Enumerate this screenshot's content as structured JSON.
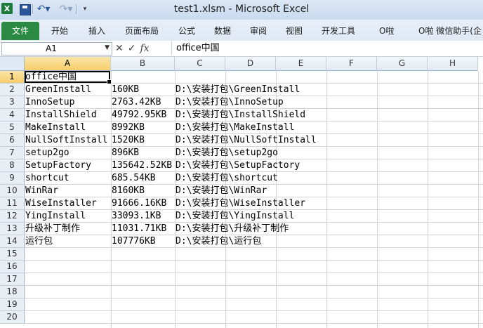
{
  "window": {
    "title": "test1.xlsm  -  Microsoft Excel"
  },
  "quick_access": {
    "icons": [
      "excel-icon",
      "save-icon",
      "undo-icon",
      "redo-icon",
      "customize-icon"
    ]
  },
  "ribbon": {
    "file_tab": "文件",
    "tabs": [
      "开始",
      "插入",
      "页面布局",
      "公式",
      "数据",
      "审阅",
      "视图",
      "开发工具",
      "O啦",
      "O啦 微信助手(企"
    ]
  },
  "formula_bar": {
    "name_box": "A1",
    "content": "office中国"
  },
  "columns": [
    "A",
    "B",
    "C",
    "D",
    "E",
    "F",
    "G",
    "H"
  ],
  "rows": [
    "1",
    "2",
    "3",
    "4",
    "5",
    "6",
    "7",
    "8",
    "9",
    "10",
    "11",
    "12",
    "13",
    "14",
    "15",
    "16",
    "17",
    "18",
    "19",
    "20"
  ],
  "cells": [
    {
      "a": "office中国",
      "b": "",
      "c": ""
    },
    {
      "a": "GreenInstall",
      "b": "160KB",
      "c": "D:\\安装打包\\GreenInstall"
    },
    {
      "a": "InnoSetup",
      "b": "2763.42KB",
      "c": "D:\\安装打包\\InnoSetup"
    },
    {
      "a": "InstallShield",
      "b": "49792.95KB",
      "c": "D:\\安装打包\\InstallShield"
    },
    {
      "a": "MakeInstall",
      "b": "8992KB",
      "c": "D:\\安装打包\\MakeInstall"
    },
    {
      "a": "NullSoftInstall",
      "b": "1520KB",
      "c": "D:\\安装打包\\NullSoftInstall"
    },
    {
      "a": "setup2go",
      "b": "896KB",
      "c": "D:\\安装打包\\setup2go"
    },
    {
      "a": "SetupFactory",
      "b": "135642.52KB",
      "c": "D:\\安装打包\\SetupFactory"
    },
    {
      "a": "shortcut",
      "b": "685.54KB",
      "c": "D:\\安装打包\\shortcut"
    },
    {
      "a": "WinRar",
      "b": "8160KB",
      "c": "D:\\安装打包\\WinRar"
    },
    {
      "a": "WiseInstaller",
      "b": "91666.16KB",
      "c": "D:\\安装打包\\WiseInstaller"
    },
    {
      "a": "YingInstall",
      "b": "33093.1KB",
      "c": "D:\\安装打包\\YingInstall"
    },
    {
      "a": "升级补丁制作",
      "b": "11031.71KB",
      "c": "D:\\安装打包\\升级补丁制作"
    },
    {
      "a": "运行包",
      "b": "107776KB",
      "c": "D:\\安装打包\\运行包"
    }
  ]
}
